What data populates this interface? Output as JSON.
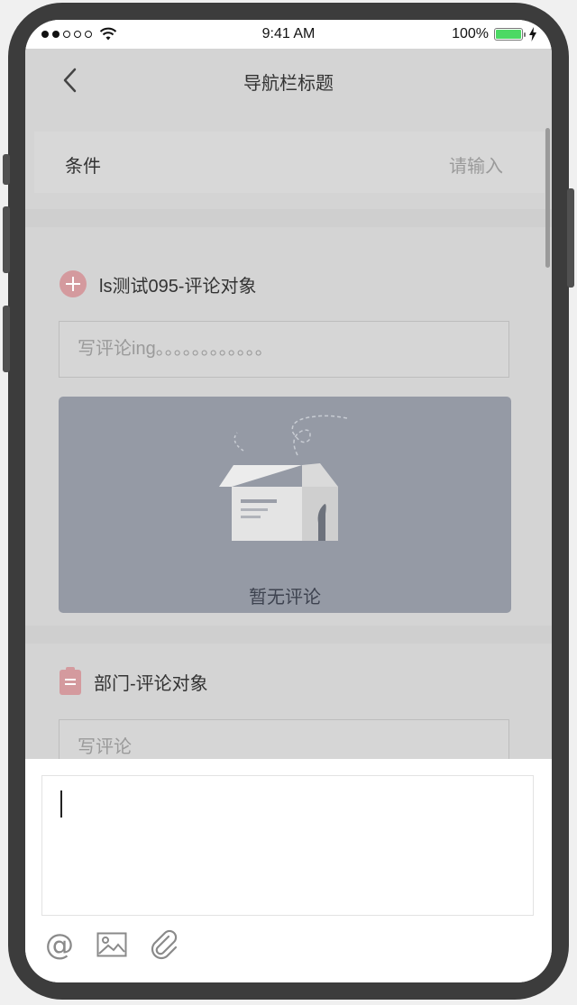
{
  "status_bar": {
    "signal_dots": [
      "full",
      "full",
      "empty",
      "empty",
      "empty"
    ],
    "time": "9:41 AM",
    "battery_percent": "100%",
    "battery_level": 1.0
  },
  "nav": {
    "title": "导航栏标题",
    "back_icon": "chevron-left-icon"
  },
  "condition": {
    "label": "条件",
    "placeholder": "请输入"
  },
  "sections": [
    {
      "title": "ls测试095-评论对象",
      "icon": "plus-circle-icon",
      "comment_placeholder": "写评论ing。。。。。。。。。。。。",
      "empty_text": "暂无评论"
    },
    {
      "title": "部门-评论对象",
      "icon": "clipboard-icon",
      "comment_placeholder": "写评论"
    }
  ],
  "composer": {
    "tools": [
      "at-icon",
      "image-icon",
      "attachment-icon"
    ],
    "at_symbol": "@"
  },
  "colors": {
    "accent_icon": "#d49a9e",
    "battery": "#4cd964",
    "empty_panel": "#959aa5",
    "overlay_bg": "#d4d4d4"
  }
}
